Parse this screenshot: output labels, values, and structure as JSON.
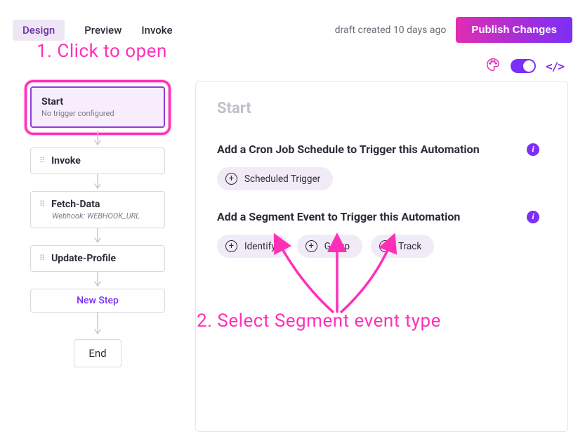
{
  "header": {
    "tabs": [
      "Design",
      "Preview",
      "Invoke"
    ],
    "active_tab": 0,
    "draft_text": "draft created 10 days ago",
    "publish_label": "Publish Changes"
  },
  "toolbar": {
    "code_glyph": "</>"
  },
  "flow": {
    "start": {
      "title": "Start",
      "sub": "No trigger configured"
    },
    "steps": [
      {
        "title": "Invoke",
        "sub": ""
      },
      {
        "title": "Fetch-Data",
        "sub": "Webhook: WEBHOOK_URL"
      },
      {
        "title": "Update-Profile",
        "sub": ""
      }
    ],
    "new_step_label": "New Step",
    "end_label": "End"
  },
  "panel": {
    "title": "Start",
    "sections": [
      {
        "heading": "Add a Cron Job Schedule to Trigger this Automation",
        "pills": [
          "Scheduled Trigger"
        ]
      },
      {
        "heading": "Add a Segment Event to Trigger this Automation",
        "pills": [
          "Identify",
          "Group",
          "Track"
        ]
      }
    ]
  },
  "annotations": {
    "step1": "1. Click to open",
    "step2": "2. Select Segment event type"
  },
  "colors": {
    "accent": "#7b2ff7",
    "annotation": "#ff2fb8"
  }
}
